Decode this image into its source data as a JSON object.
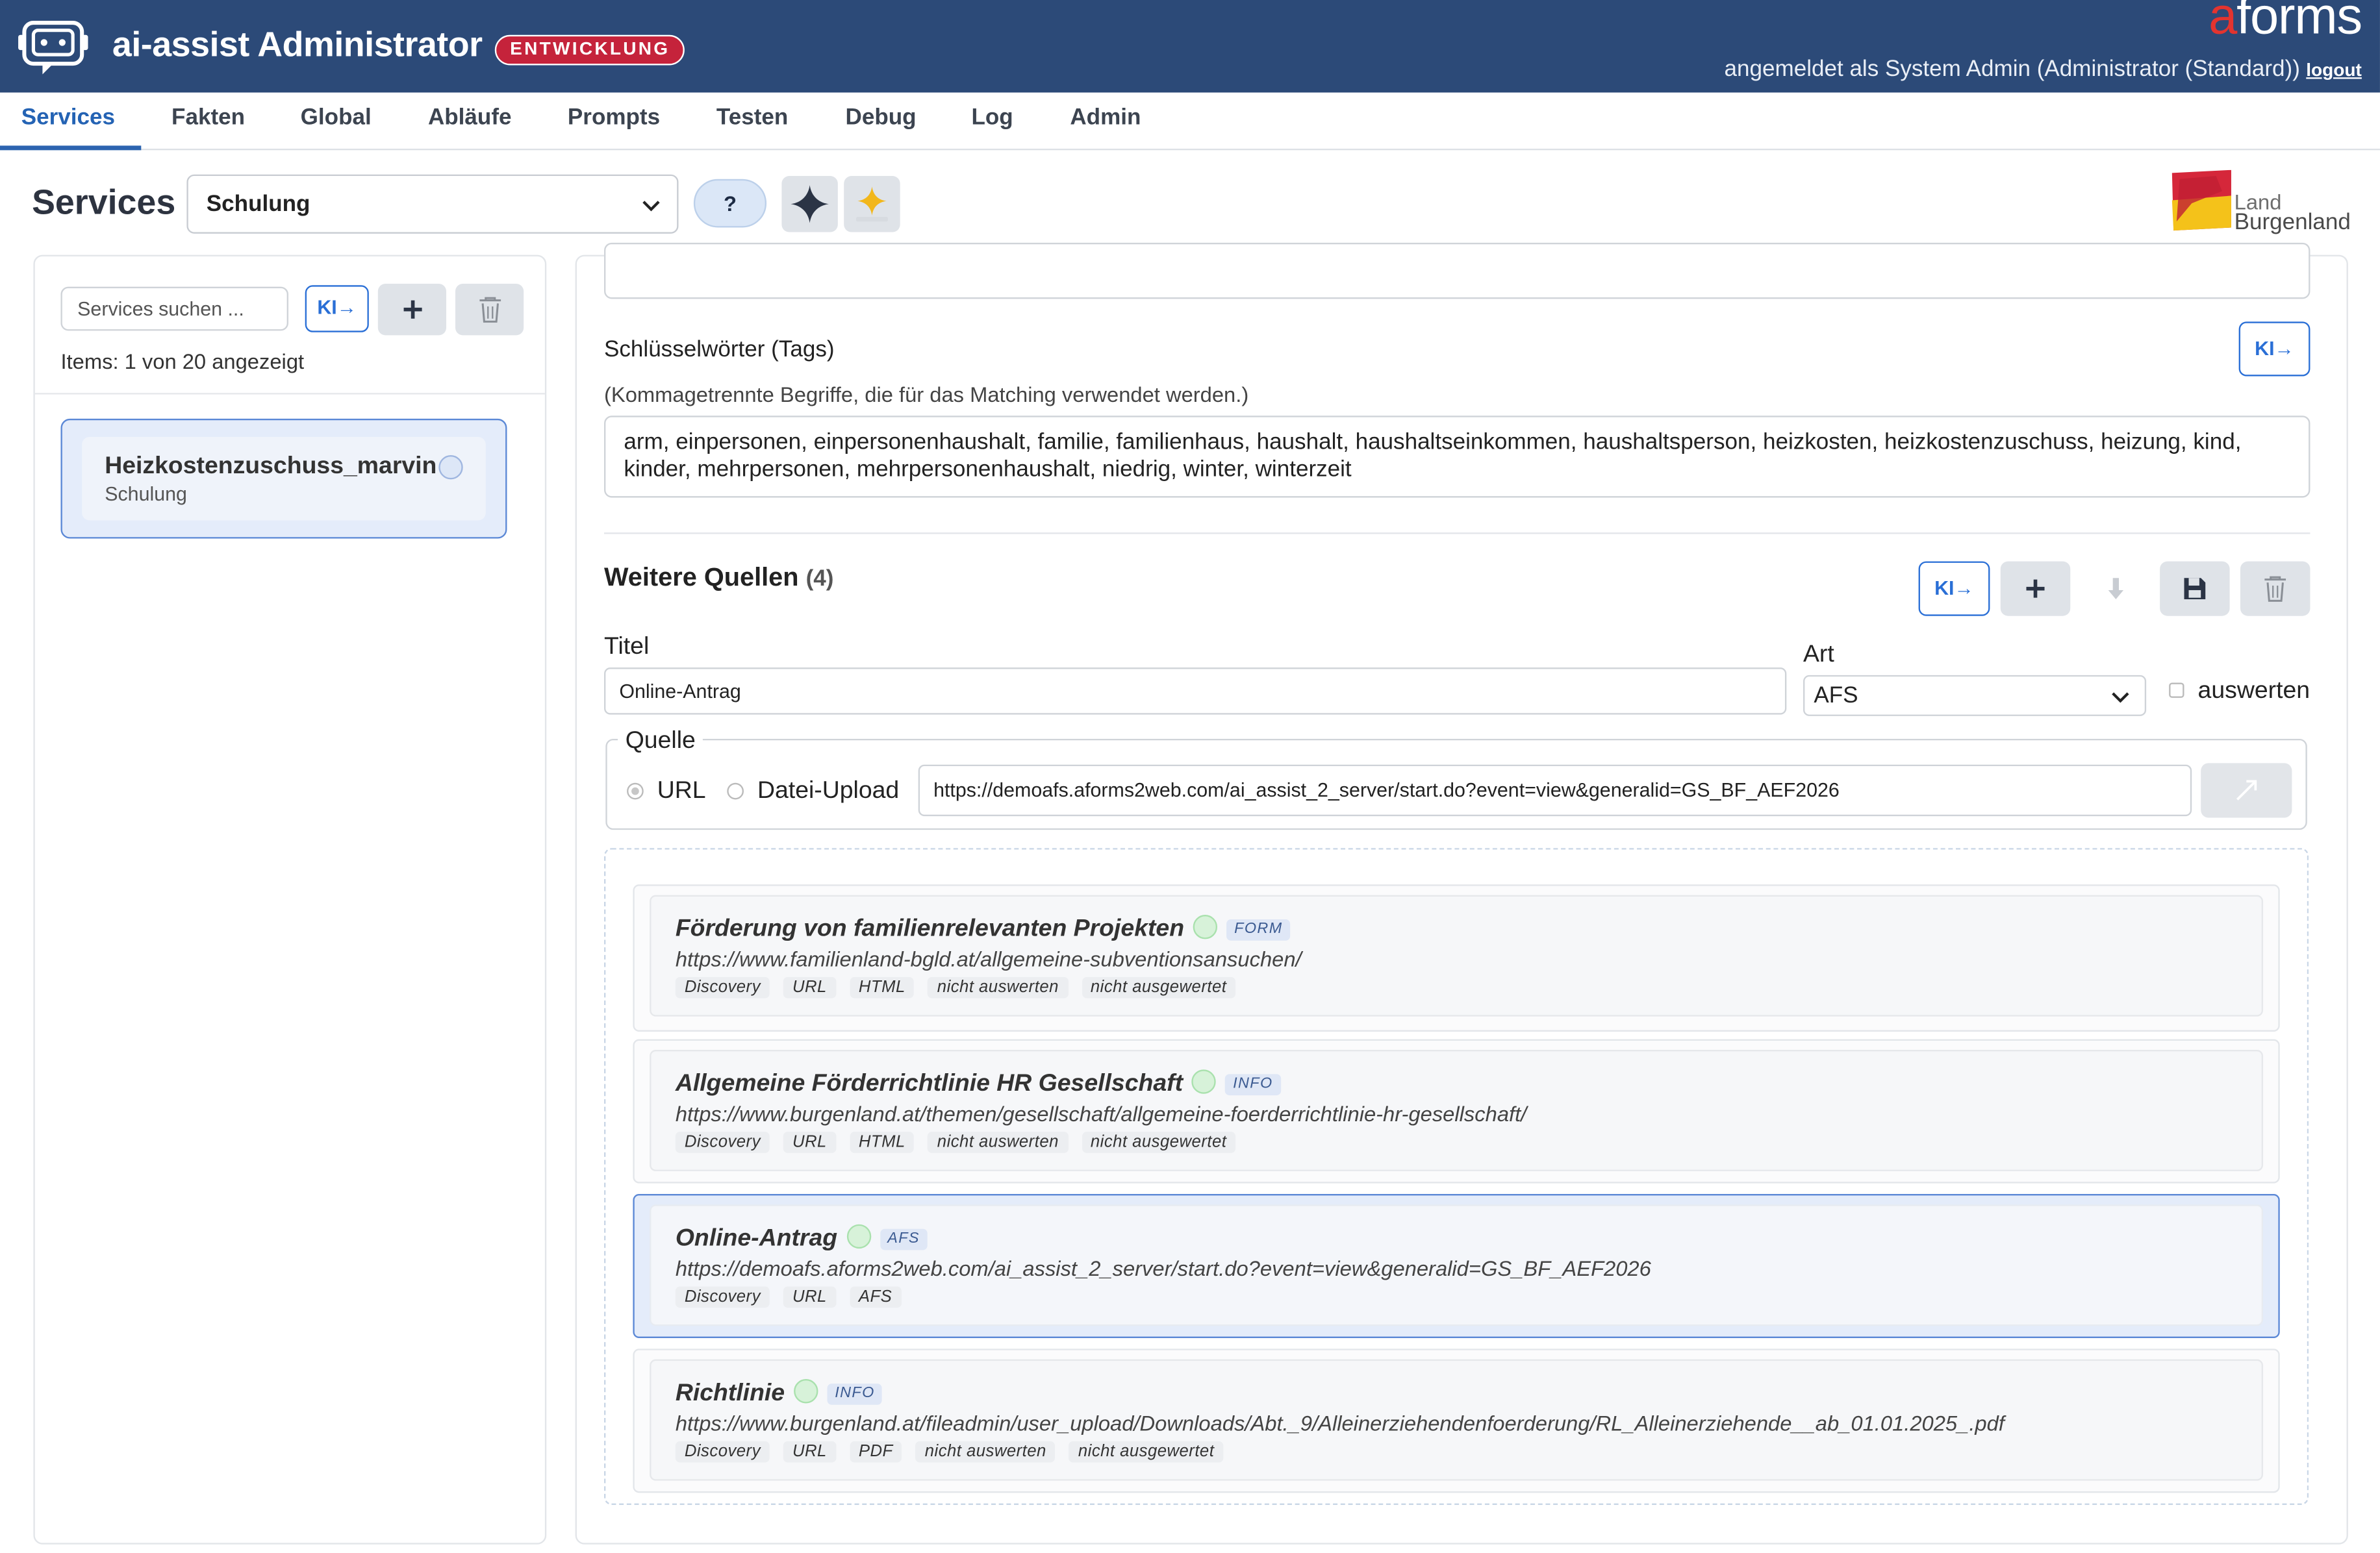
{
  "header": {
    "app_title": "ai-assist Administrator",
    "env_badge": "ENTWICKLUNG",
    "brand_a": "a",
    "brand_rest": "forms",
    "user_text": "angemeldet als System Admin (Administrator (Standard))",
    "logout_label": "logout",
    "colors": {
      "bar": "#2c4a78",
      "badge": "#c5233b"
    }
  },
  "nav": {
    "tabs": [
      {
        "label": "Services",
        "active": true
      },
      {
        "label": "Fakten"
      },
      {
        "label": "Global"
      },
      {
        "label": "Abläufe"
      },
      {
        "label": "Prompts"
      },
      {
        "label": "Testen"
      },
      {
        "label": "Debug"
      },
      {
        "label": "Log"
      },
      {
        "label": "Admin"
      }
    ]
  },
  "page": {
    "title": "Services",
    "selected_group": "Schulung",
    "help_label": "?",
    "logo_text_1": "Land",
    "logo_text_2": "Burgenland"
  },
  "left": {
    "search_placeholder": "Services suchen ...",
    "ki_label": "KI→",
    "items_text": "Items: 1 von 20 angezeigt",
    "services": [
      {
        "name": "Heizkostenzuschuss_marvin",
        "group": "Schulung"
      }
    ]
  },
  "right": {
    "tags_label": "Schlüsselwörter (Tags)",
    "tags_hint": "(Kommagetrennte Begriffe, die für das Matching verwendet werden.)",
    "tags_value": "arm, einpersonen, einpersonenhaushalt, familie, familienhaus, haushalt, haushaltseinkommen, haushaltsperson, heizkosten, heizkostenzuschuss, heizung, kind, kinder, mehrpersonen, mehrpersonenhaushalt, niedrig, winter, winterzeit",
    "ki_label": "KI→",
    "sources_title": "Weitere Quellen",
    "sources_count": "(4)",
    "titel_label": "Titel",
    "titel_value": "Online-Antrag",
    "art_label": "Art",
    "art_value": "AFS",
    "auswerten_label": "auswerten",
    "quelle_label": "Quelle",
    "url_radio": "URL",
    "upload_radio": "Datei-Upload",
    "url_value": "https://demoafs.aforms2web.com/ai_assist_2_server/start.do?event=view&generalid=GS_BF_AEF2026"
  },
  "sources": [
    {
      "title": "Förderung von familienrelevanten Projekten",
      "type": "FORM",
      "url": "https://www.familienland-bgld.at/allgemeine-subventionsansuchen/",
      "chips": [
        "Discovery",
        "URL",
        "HTML",
        "nicht auswerten",
        "nicht ausgewertet"
      ]
    },
    {
      "title": "Allgemeine Förderrichtlinie HR Gesellschaft",
      "type": "INFO",
      "url": "https://www.burgenland.at/themen/gesellschaft/allgemeine-foerderrichtlinie-hr-gesellschaft/",
      "chips": [
        "Discovery",
        "URL",
        "HTML",
        "nicht auswerten",
        "nicht ausgewertet"
      ]
    },
    {
      "title": "Online-Antrag",
      "type": "AFS",
      "url": "https://demoafs.aforms2web.com/ai_assist_2_server/start.do?event=view&generalid=GS_BF_AEF2026",
      "chips": [
        "Discovery",
        "URL",
        "AFS"
      ],
      "selected": true
    },
    {
      "title": "Richtlinie",
      "type": "INFO",
      "url": "https://www.burgenland.at/fileadmin/user_upload/Downloads/Abt._9/Alleinerziehendenfoerderung/RL_Alleinerziehende__ab_01.01.2025_.pdf",
      "chips": [
        "Discovery",
        "URL",
        "PDF",
        "nicht auswerten",
        "nicht ausgewertet"
      ]
    }
  ]
}
